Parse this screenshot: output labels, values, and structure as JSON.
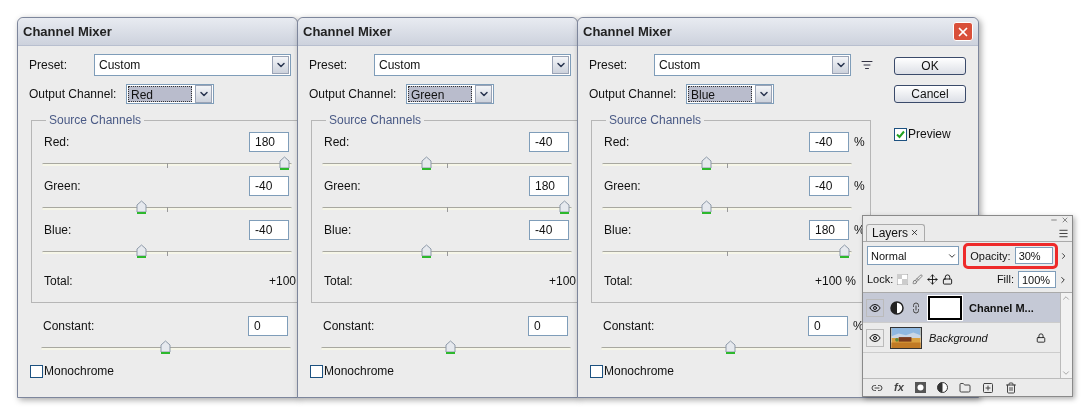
{
  "dialogs": [
    {
      "title": "Channel Mixer",
      "closable": false,
      "preset_label": "Preset:",
      "preset": "Custom",
      "output_label": "Output Channel:",
      "output": "Red",
      "group": "Source Channels",
      "channels": [
        {
          "label": "Red:",
          "value": "180",
          "level": 0.97
        },
        {
          "label": "Green:",
          "value": "-40",
          "level": 0.4
        },
        {
          "label": "Blue:",
          "value": "-40",
          "level": 0.4
        }
      ],
      "total_label": "Total:",
      "total": "+100",
      "constant": {
        "label": "Constant:",
        "value": "0",
        "level": 0.5
      },
      "monochrome": {
        "label": "Monochrome",
        "checked": false
      }
    },
    {
      "title": "Channel Mixer",
      "closable": false,
      "preset_label": "Preset:",
      "preset": "Custom",
      "output_label": "Output Channel:",
      "output": "Green",
      "group": "Source Channels",
      "channels": [
        {
          "label": "Red:",
          "value": "-40",
          "level": 0.42
        },
        {
          "label": "Green:",
          "value": "180",
          "level": 0.97
        },
        {
          "label": "Blue:",
          "value": "-40",
          "level": 0.42
        }
      ],
      "total_label": "Total:",
      "total": "+100",
      "constant": {
        "label": "Constant:",
        "value": "0",
        "level": 0.52
      },
      "monochrome": {
        "label": "Monochrome",
        "checked": false
      }
    },
    {
      "title": "Channel Mixer",
      "closable": true,
      "preset_label": "Preset:",
      "preset": "Custom",
      "preset_menu": true,
      "output_label": "Output Channel:",
      "output": "Blue",
      "group": "Source Channels",
      "channels": [
        {
          "label": "Red:",
          "value": "-40",
          "unit": "%",
          "level": 0.42
        },
        {
          "label": "Green:",
          "value": "-40",
          "unit": "%",
          "level": 0.42
        },
        {
          "label": "Blue:",
          "value": "180",
          "unit": "%",
          "level": 0.97
        }
      ],
      "total_label": "Total:",
      "total": "+100 %",
      "constant": {
        "label": "Constant:",
        "value": "0",
        "unit": "%",
        "level": 0.52
      },
      "monochrome": {
        "label": "Monochrome",
        "checked": false
      },
      "buttons": [
        "OK",
        "Cancel"
      ],
      "preview": {
        "label": "Preview",
        "checked": true
      }
    }
  ],
  "layers_panel": {
    "tab": "Layers",
    "blend_mode": "Normal",
    "opacity_label": "Opacity:",
    "opacity": "30%",
    "opacity_highlighted": true,
    "lock_label": "Lock:",
    "fill_label": "Fill:",
    "fill": "100%",
    "layers": [
      {
        "name": "Channel M...",
        "kind": "adjustment",
        "visible": true,
        "selected": true,
        "locked": false
      },
      {
        "name": "Background",
        "kind": "background",
        "visible": true,
        "selected": false,
        "locked": true
      }
    ],
    "fx_label": "fx"
  }
}
